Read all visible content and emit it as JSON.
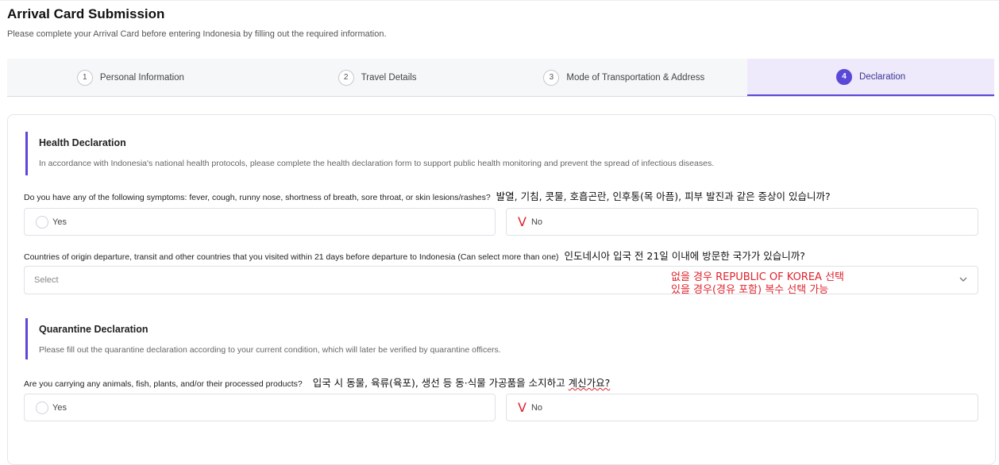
{
  "header": {
    "title": "Arrival Card Submission",
    "subtitle": "Please complete your Arrival Card before entering Indonesia by filling out the required information."
  },
  "steps": [
    {
      "num": "1",
      "label": "Personal Information",
      "active": false
    },
    {
      "num": "2",
      "label": "Travel Details",
      "active": false
    },
    {
      "num": "3",
      "label": "Mode of Transportation & Address",
      "active": false
    },
    {
      "num": "4",
      "label": "Declaration",
      "active": true
    }
  ],
  "health": {
    "title": "Health Declaration",
    "desc": "In accordance with Indonesia's national health protocols, please complete the health declaration form to support public health monitoring and prevent the spread of infectious diseases.",
    "symptoms_question": "Do you have any of the following symptoms: fever, cough, runny nose, shortness of breath, sore throat, or skin lesions/rashes?",
    "symptoms_note_kr": "발열, 기침, 콧물, 호흡곤란, 인후통(목 아픔), 피부 발진과 같은 증상이 있습니까?",
    "yes_label": "Yes",
    "no_label": "No",
    "selected_mark": "V",
    "countries_question": "Countries of origin departure, transit and other countries that you visited within 21 days before departure to Indonesia (Can select more than one)",
    "countries_note_kr": "인도네시아 입국 전 21일 이내에 방문한 국가가 있습니까?",
    "countries_placeholder": "Select",
    "annotation_line1": "없을 경우 REPUBLIC OF KOREA 선택",
    "annotation_line2": "있을 경우(경유 포함) 복수 선택 가능"
  },
  "quarantine": {
    "title": "Quarantine Declaration",
    "desc": "Please fill out the quarantine declaration according to your current condition, which will later be verified by quarantine officers.",
    "question": "Are you carrying any animals, fish, plants, and/or their processed products?",
    "note_kr_main": "입국 시 동물, 육류(육포), 생선 등 동·식물 가공품을 소지하고 ",
    "note_kr_tail": "계신가요?",
    "yes_label": "Yes",
    "no_label": "No",
    "selected_mark": "V"
  },
  "colors": {
    "accent": "#5a48d8",
    "annotation": "#e0232d"
  },
  "icons": [
    "chevron-down-icon",
    "radio-icon"
  ]
}
